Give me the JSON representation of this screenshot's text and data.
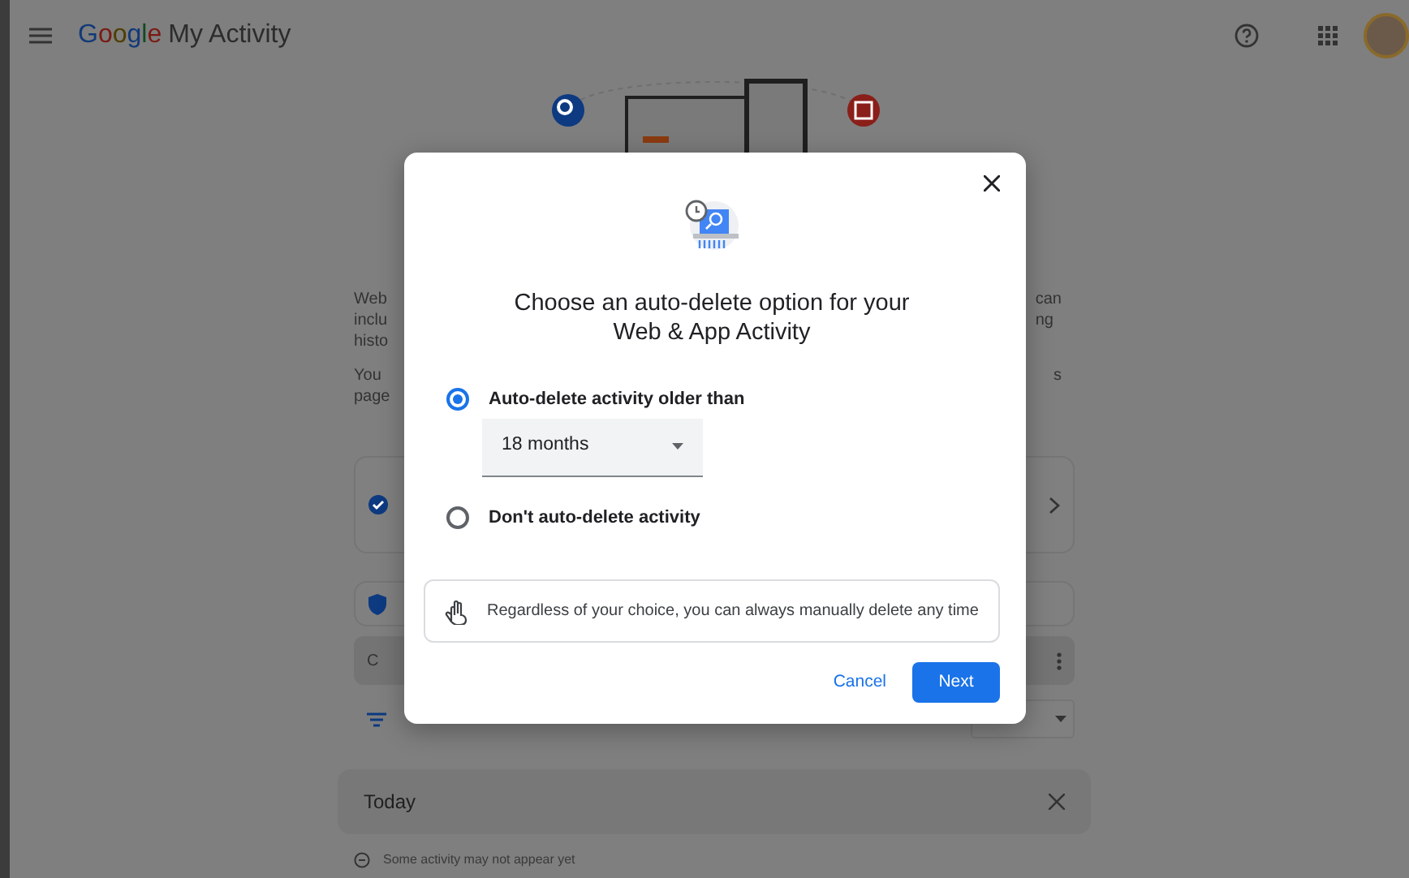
{
  "header": {
    "logo": "Google",
    "title": "My Activity"
  },
  "background": {
    "intro_left": [
      "Web",
      "inclu",
      "histo"
    ],
    "intro_right": [
      "can",
      "ng"
    ],
    "note_left": [
      "You",
      "page"
    ],
    "note_right": [
      "s"
    ],
    "search_fragment": "C",
    "today": "Today",
    "notice": "Some activity may not appear yet"
  },
  "dialog": {
    "title": "Choose an auto-delete option for your Web & App Activity",
    "options": [
      {
        "label": "Auto-delete activity older than",
        "selected": true,
        "select": "18 months"
      },
      {
        "label": "Don't auto-delete activity",
        "selected": false
      }
    ],
    "info": "Regardless of your choice, you can always manually delete any time",
    "buttons": [
      {
        "label": "Cancel",
        "kind": "text"
      },
      {
        "label": "Next",
        "kind": "primary"
      }
    ]
  }
}
